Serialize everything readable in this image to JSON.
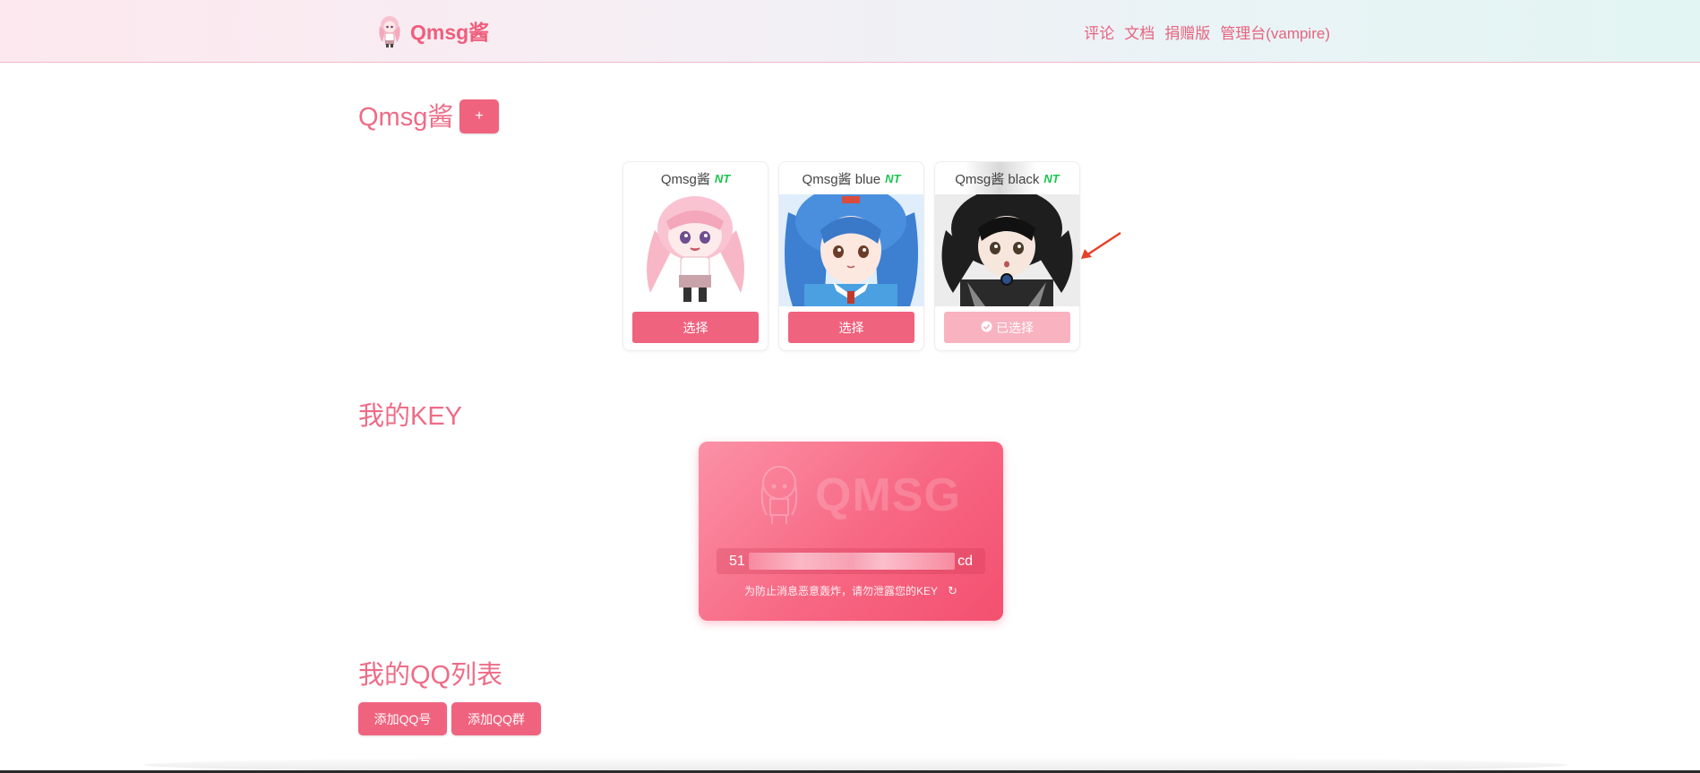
{
  "nav": {
    "brand": "Qmsg酱",
    "links": [
      "评论",
      "文档",
      "捐赠版",
      "管理台(vampire)"
    ]
  },
  "bots_section": {
    "title": "Qmsg酱",
    "add_label": "+",
    "cards": [
      {
        "name": "Qmsg酱",
        "badge": "NT",
        "button": "选择",
        "selected": false,
        "theme": "pink"
      },
      {
        "name": "Qmsg酱 blue",
        "badge": "NT",
        "button": "选择",
        "selected": false,
        "theme": "blue"
      },
      {
        "name": "Qmsg酱 black",
        "badge": "NT",
        "button": "已选择",
        "selected": true,
        "theme": "black"
      }
    ]
  },
  "key_section": {
    "title": "我的KEY",
    "watermark": "QMSG",
    "key_prefix": "51",
    "key_suffix": "cd",
    "hint": "为防止消息恶意轰炸，请勿泄露您的KEY",
    "refresh_icon": "refresh-icon"
  },
  "qq_section": {
    "title": "我的QQ列表",
    "add_qq": "添加QQ号",
    "add_group": "添加QQ群"
  },
  "colors": {
    "accent": "#f0637f",
    "title": "#ee6c87",
    "nt": "#1bc44f",
    "selected": "#f8b2c0"
  }
}
